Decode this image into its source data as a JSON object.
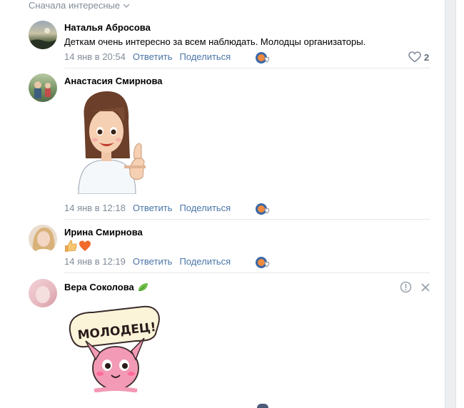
{
  "sort_label": "Сначала интересные",
  "comments": [
    {
      "author": "Наталья Абросова",
      "text": "Деткам очень интересно за всем наблюдать. Молодцы организаторы.",
      "time": "14 янв в 20:54",
      "reply": "Ответить",
      "share": "Поделиться",
      "likes": "2"
    },
    {
      "author": "Анастасия Смирнова",
      "time": "14 янв в 12:18",
      "reply": "Ответить",
      "share": "Поделиться"
    },
    {
      "author": "Ирина Смирнова",
      "time": "14 янв в 12:19",
      "reply": "Ответить",
      "share": "Поделиться"
    },
    {
      "author": "Вера Соколова",
      "sticker_text": "МОЛОДЕЦ!"
    }
  ],
  "colors": {
    "link": "#4a76a8",
    "meta": "#818c99",
    "background": "#edeef0"
  }
}
